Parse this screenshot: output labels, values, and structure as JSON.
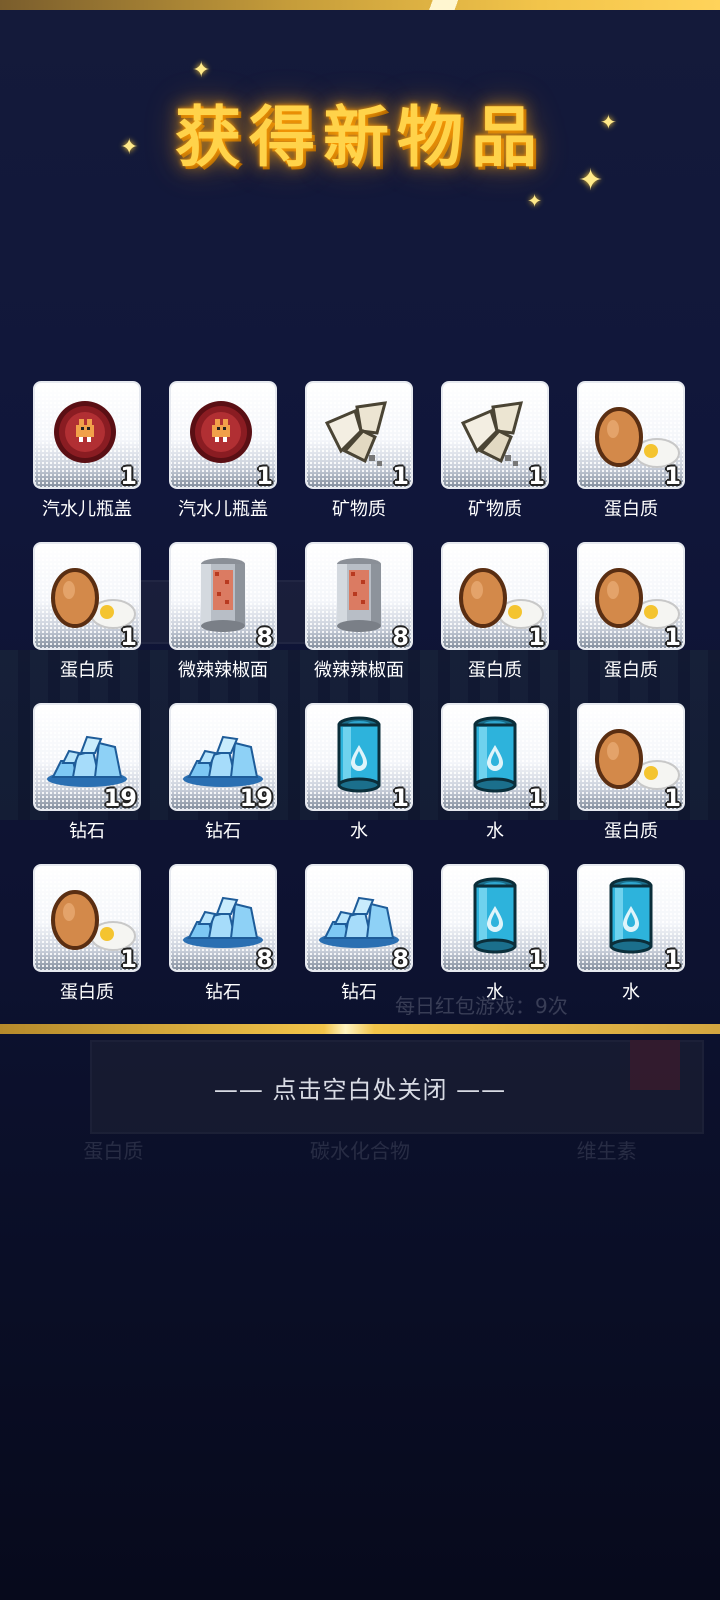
{
  "popup": {
    "title": "获得新物品",
    "close_hint": "—— 点击空白处关闭 ——"
  },
  "items": [
    {
      "name": "汽水儿瓶盖",
      "count": "1",
      "icon": "bottle-cap-icon"
    },
    {
      "name": "汽水儿瓶盖",
      "count": "1",
      "icon": "bottle-cap-icon"
    },
    {
      "name": "矿物质",
      "count": "1",
      "icon": "mineral-icon"
    },
    {
      "name": "矿物质",
      "count": "1",
      "icon": "mineral-icon"
    },
    {
      "name": "蛋白质",
      "count": "1",
      "icon": "egg-icon"
    },
    {
      "name": "蛋白质",
      "count": "1",
      "icon": "egg-icon"
    },
    {
      "name": "微辣辣椒面",
      "count": "8",
      "icon": "chili-can-icon"
    },
    {
      "name": "微辣辣椒面",
      "count": "8",
      "icon": "chili-can-icon"
    },
    {
      "name": "蛋白质",
      "count": "1",
      "icon": "egg-icon"
    },
    {
      "name": "蛋白质",
      "count": "1",
      "icon": "egg-icon"
    },
    {
      "name": "钻石",
      "count": "19",
      "icon": "diamond-icon"
    },
    {
      "name": "钻石",
      "count": "19",
      "icon": "diamond-icon"
    },
    {
      "name": "水",
      "count": "1",
      "icon": "water-can-icon"
    },
    {
      "name": "水",
      "count": "1",
      "icon": "water-can-icon"
    },
    {
      "name": "蛋白质",
      "count": "1",
      "icon": "egg-icon"
    },
    {
      "name": "蛋白质",
      "count": "1",
      "icon": "egg-icon"
    },
    {
      "name": "钻石",
      "count": "8",
      "icon": "diamond-icon"
    },
    {
      "name": "钻石",
      "count": "8",
      "icon": "diamond-icon"
    },
    {
      "name": "水",
      "count": "1",
      "icon": "water-can-icon"
    },
    {
      "name": "水",
      "count": "1",
      "icon": "water-can-icon"
    }
  ],
  "background": {
    "daily_text": "每日红包游戏：9次",
    "labels": [
      "蛋白质",
      "碳水化合物",
      "维生素"
    ]
  },
  "colors": {
    "title": "#ffd34a",
    "accent_bar": "#f2c44a",
    "background": "#10163a"
  }
}
